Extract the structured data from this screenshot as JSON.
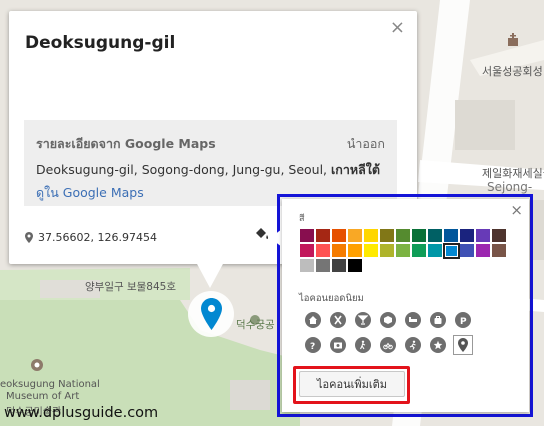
{
  "map": {
    "label_seoul_anglican": "서울성공회성",
    "label_jeil": "제일화재세실극",
    "label_sejong": "Sejong-",
    "label_bomul": "양부일구 보물845호",
    "label_deoksu": "덕수궁공",
    "label_museum_1": "eoksugung National",
    "label_museum_2": "Museum of Art",
    "label_museum_3": "덕수궁미술관"
  },
  "card": {
    "title": "Deoksugung-gil",
    "close": "×",
    "details_heading": "รายละเอียดจาก Google Maps",
    "details_import": "นำออก",
    "address_plain": "Deoksugung-gil, Sogong-dong, Jung-gu, Seoul, ",
    "address_bold": "เกาหลีใต้",
    "view_prefix": "ดูใน",
    "view_link": "Google Maps",
    "coords": "37.56602, 126.97454"
  },
  "popup": {
    "close": "×",
    "color_label": "สี",
    "icons_label": "ไอคอนยอดนิยม",
    "more_icons": "ไอคอนเพิ่มเติม",
    "colors": [
      [
        "#880e4f",
        "#a52714",
        "#e65100",
        "#f9a825",
        "#ffd600",
        "#817717",
        "#558b2f",
        "#097138",
        "#006064",
        "#01579b",
        "#1a237e",
        "#673ab7",
        "#4e342e"
      ],
      [
        "#c2185b",
        "#ff5252",
        "#f57c00",
        "#ffa000",
        "#ffea00",
        "#afb42b",
        "#7cb342",
        "#0f9d58",
        "#0097a7",
        "#0288d1",
        "#3f51b5",
        "#9c27b0",
        "#795548"
      ],
      [
        "#bdbdbd",
        "#757575",
        "#424242",
        "#000000"
      ]
    ],
    "selected_color": "#0288d1",
    "icons_row1": [
      "home-icon",
      "restaurant-icon",
      "bar-icon",
      "shopping-icon",
      "hotel-icon",
      "camera-bag-icon",
      "parking-icon"
    ],
    "icons_row2": [
      "help-icon",
      "photo-icon",
      "hiking-icon",
      "cycling-icon",
      "running-icon",
      "star-icon",
      "pin-icon"
    ],
    "selected_icon": "pin-icon"
  },
  "watermark": "www.dplusguide.com"
}
